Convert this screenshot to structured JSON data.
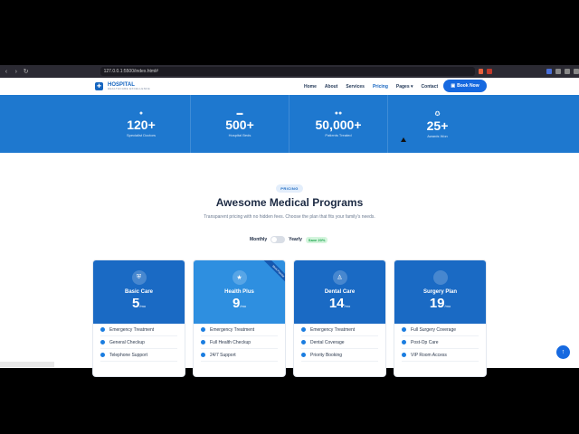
{
  "browser": {
    "url": "127.0.0.1:5500/index.html#"
  },
  "header": {
    "logo_title": "HOSPITAL",
    "logo_sub": "HEALTHCARE EXCELLENCE",
    "nav": [
      "Home",
      "About",
      "Services",
      "Pricing",
      "Pages",
      "Contact"
    ],
    "active_nav": "Pricing",
    "book_label": "Book Now"
  },
  "stats": [
    {
      "icon": "doctor-icon",
      "value": "120+",
      "label": "Specialist Doctors"
    },
    {
      "icon": "bed-icon",
      "value": "500+",
      "label": "Hospital Beds"
    },
    {
      "icon": "users-icon",
      "value": "50,000+",
      "label": "Patients Treated"
    },
    {
      "icon": "award-icon",
      "value": "25+",
      "label": "Awards Won"
    }
  ],
  "pricing": {
    "pill": "PRICING",
    "title": "Awesome Medical Programs",
    "subtitle": "Transparent pricing with no hidden fees. Choose the plan that fits your family's needs.",
    "toggle_monthly": "Monthly",
    "toggle_yearly": "Yearly",
    "save_badge": "Save 20%",
    "cards": [
      {
        "icon": "shield-icon",
        "name": "Basic Care",
        "price": "5",
        "per": "/mo",
        "features": [
          "Emergency Treatment",
          "General Checkup",
          "Telephone Support"
        ]
      },
      {
        "icon": "star-icon",
        "name": "Health Plus",
        "price": "9",
        "per": "/mo",
        "ribbon": "Most Popular",
        "features": [
          "Emergency Treatment",
          "Full Health Checkup",
          "24/7 Support"
        ]
      },
      {
        "icon": "tooth-icon",
        "name": "Dental Care",
        "price": "14",
        "per": "/mo",
        "features": [
          "Emergency Treatment",
          "Dental Coverage",
          "Priority Booking"
        ]
      },
      {
        "icon": "surgery-icon",
        "name": "Surgery Plan",
        "price": "19",
        "per": "/mo",
        "features": [
          "Full Surgery Coverage",
          "Post-Op Care",
          "VIP Room Access"
        ]
      }
    ]
  },
  "colors": {
    "brand": "#1565c0",
    "band": "#1e78cf",
    "button": "#1669e0",
    "save": "#19a34a"
  }
}
